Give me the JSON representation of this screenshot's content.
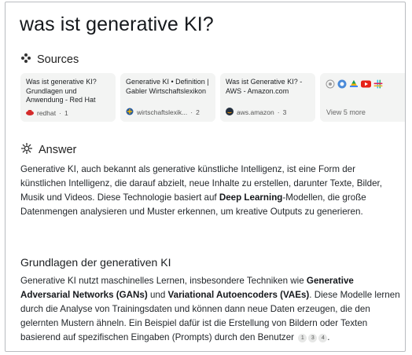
{
  "page": {
    "title": "was ist generative KI?"
  },
  "sources": {
    "heading": "Sources",
    "cards": [
      {
        "title": "Was ist generative KI? Grundlagen und Anwendung - Red Hat",
        "site": "redhat",
        "num": "1",
        "favicon_color": "#d42b2b"
      },
      {
        "title": "Generative KI • Definition | Gabler Wirtschaftslexikon",
        "site": "wirtschaftslexik...",
        "num": "2",
        "favicon_color": "#2a5b9c"
      },
      {
        "title": "Was ist Generative KI? - AWS - Amazon.com",
        "site": "aws.amazon",
        "num": "3",
        "favicon_color": "#232f3e"
      }
    ],
    "more_label": "View 5 more"
  },
  "answer": {
    "heading": "Answer",
    "p1_a": "Generative KI, auch bekannt als generative künstliche Intelligenz, ist eine Form der künstlichen Intelligenz, die darauf abzielt, neue Inhalte zu erstellen, darunter Texte, Bilder, Musik und Videos. Diese Technologie basiert auf ",
    "p1_b": "Deep Learning",
    "p1_c": "-Modellen, die große Datenmengen analysieren und Muster erkennen, um kreative Outputs zu generieren.",
    "subheading": "Grundlagen der generativen KI",
    "p2_a": "Generative KI nutzt maschinelles Lernen, insbesondere Techniken wie ",
    "p2_b": "Generative Adversarial Networks (GANs)",
    "p2_c": " und ",
    "p2_d": "Variational Autoencoders (VAEs)",
    "p2_e": ". Diese Modelle lernen durch die Analyse von Trainingsdaten und können dann neue Daten erzeugen, die den gelernten Mustern ähneln. Ein Beispiel dafür ist die Erstellung von Bildern oder Texten basierend auf spezifischen Eingaben (Prompts) durch den Benutzer",
    "citations": [
      "1",
      "3",
      "4"
    ],
    "p2_end": "."
  }
}
